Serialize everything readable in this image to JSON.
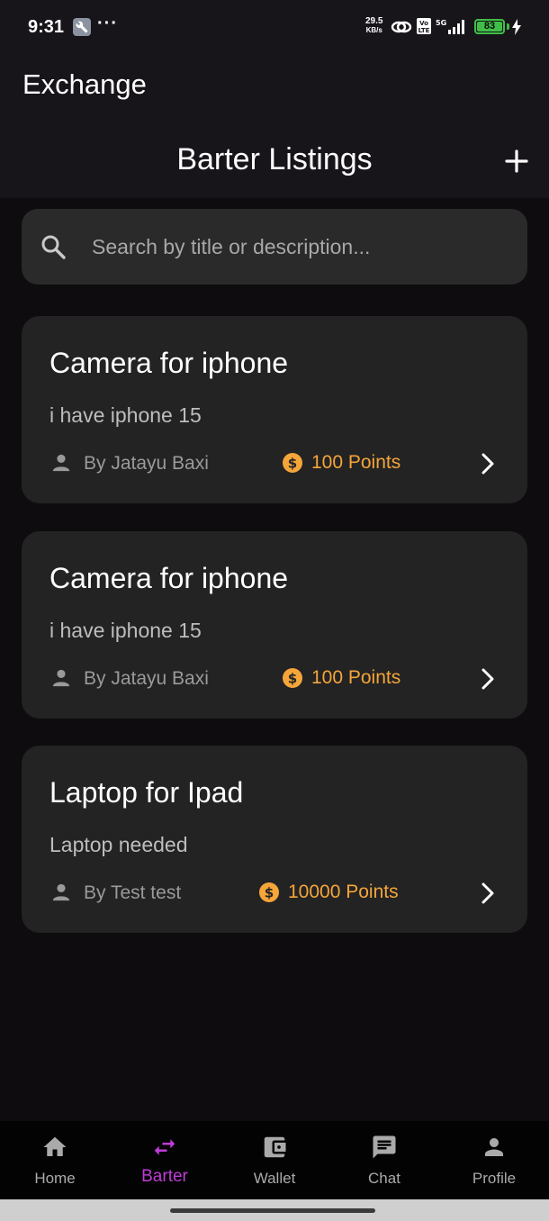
{
  "status_bar": {
    "time": "9:31",
    "dots": "···",
    "net_speed_value": "29.5",
    "net_speed_unit": "KB/s",
    "battery": "83"
  },
  "header": {
    "app_title": "Exchange",
    "page_title": "Barter Listings"
  },
  "search": {
    "placeholder": "Search by title or description..."
  },
  "listings": [
    {
      "title": "Camera for iphone",
      "description": "i have iphone 15",
      "author": "By Jatayu Baxi",
      "points": "100 Points"
    },
    {
      "title": "Camera for iphone",
      "description": "i have iphone 15",
      "author": "By Jatayu Baxi",
      "points": "100 Points"
    },
    {
      "title": "Laptop for Ipad",
      "description": "Laptop needed",
      "author": "By Test test",
      "points": "10000 Points"
    }
  ],
  "nav": [
    {
      "label": "Home",
      "icon": "home-icon"
    },
    {
      "label": "Barter",
      "icon": "swap-icon",
      "active": true
    },
    {
      "label": "Wallet",
      "icon": "wallet-icon"
    },
    {
      "label": "Chat",
      "icon": "chat-icon"
    },
    {
      "label": "Profile",
      "icon": "person-icon"
    }
  ],
  "colors": {
    "accent": "#c03cd8",
    "points": "#f5a53a",
    "card_bg": "#232323",
    "page_bg": "#0e0c0e",
    "appbar_bg": "#17141a"
  }
}
